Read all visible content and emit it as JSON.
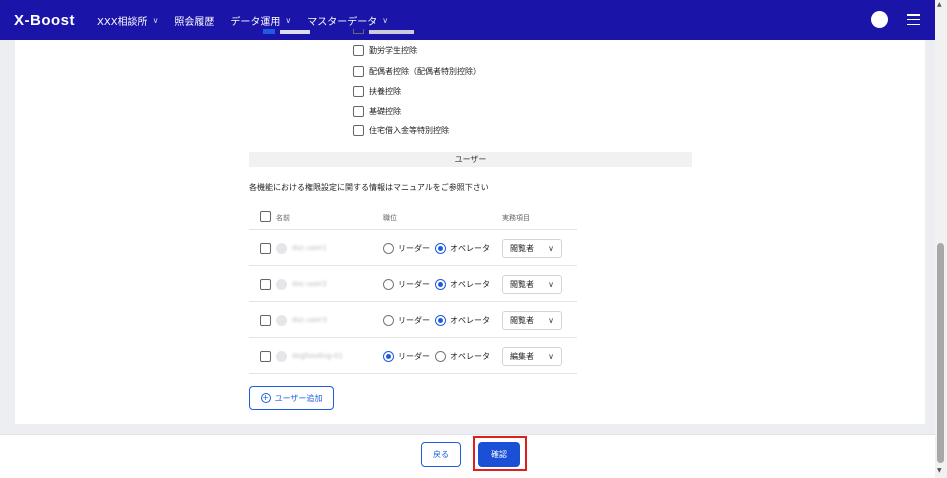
{
  "topnav": {
    "logo": "X-Boost",
    "items": [
      {
        "label": "XXX相談所",
        "has_dropdown": true
      },
      {
        "label": "照会履歴",
        "has_dropdown": false
      },
      {
        "label": "データ運用",
        "has_dropdown": true
      },
      {
        "label": "マスターデータ",
        "has_dropdown": true
      }
    ],
    "avatar_icon": "user-avatar",
    "menu_icon": "hamburger-icon",
    "colors": {
      "bar": "#1a14a8",
      "text": "#ffffff"
    }
  },
  "deductions": [
    {
      "label": "勤労学生控除",
      "checked": false
    },
    {
      "label": "配偶者控除（配偶者特別控除）",
      "checked": false
    },
    {
      "label": "扶養控除",
      "checked": false
    },
    {
      "label": "基礎控除",
      "checked": false
    },
    {
      "label": "住宅借入金等特別控除",
      "checked": false
    }
  ],
  "users_section": {
    "title": "ユーザー",
    "info": "各機能における権限設定に関する情報はマニュアルをご参照下さい",
    "columns": {
      "name": "名前",
      "role": "職位",
      "item": "実務項目"
    },
    "role_options": {
      "leader": "リーダー",
      "operator": "オペレータ"
    },
    "rows": [
      {
        "name": "doc-user1",
        "role": "operator",
        "permission": "閲覧者"
      },
      {
        "name": "doc-user2",
        "role": "operator",
        "permission": "閲覧者"
      },
      {
        "name": "doc-user3",
        "role": "operator",
        "permission": "閲覧者"
      },
      {
        "name": "dogfooding-01",
        "role": "leader",
        "permission": "編集者"
      }
    ],
    "add_user_label": "ユーザー追加"
  },
  "footer": {
    "back_label": "戻る",
    "confirm_label": "確認",
    "accent": "#1a4fd6",
    "highlight": "#e21d1d"
  }
}
